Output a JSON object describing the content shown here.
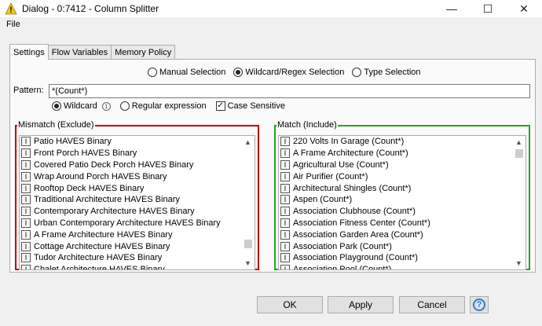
{
  "window": {
    "title": "Dialog - 0:7412 - Column Splitter",
    "minimize": "—",
    "maximize": "☐",
    "close": "✕"
  },
  "menu": {
    "file": "File"
  },
  "tabs": [
    {
      "label": "Settings",
      "active": true
    },
    {
      "label": "Flow Variables",
      "active": false
    },
    {
      "label": "Memory Policy",
      "active": false
    }
  ],
  "selection_modes": [
    {
      "label": "Manual Selection",
      "selected": false
    },
    {
      "label": "Wildcard/Regex Selection",
      "selected": true
    },
    {
      "label": "Type Selection",
      "selected": false
    }
  ],
  "pattern": {
    "label": "Pattern:",
    "value": "*(Count*)"
  },
  "pattern_options": {
    "wildcard": "Wildcard",
    "info": "i",
    "regex": "Regular expression",
    "case_sensitive": "Case Sensitive",
    "case_check": "✓"
  },
  "type_icon": "I",
  "mismatch": {
    "legend": "Mismatch (Exclude)",
    "items": [
      "Patio HAVES Binary",
      "Front Porch HAVES Binary",
      "Covered Patio Deck Porch HAVES Binary",
      "Wrap Around Porch HAVES Binary",
      "Rooftop Deck HAVES Binary",
      "Traditional Architecture HAVES Binary",
      "Contemporary Architecture HAVES Binary",
      "Urban Contemporary Architecture HAVES Binary",
      "A Frame Architecture HAVES Binary",
      "Cottage Architecture HAVES Binary",
      "Tudor Architecture HAVES Binary",
      "Chalet Architecture HAVES Binary"
    ]
  },
  "match": {
    "legend": "Match (Include)",
    "items": [
      "220 Volts In Garage (Count*)",
      "A Frame Architecture (Count*)",
      "Agricultural Use (Count*)",
      "Air Purifier (Count*)",
      "Architectural Shingles (Count*)",
      "Aspen (Count*)",
      "Association Clubhouse (Count*)",
      "Association Fitness Center (Count*)",
      "Association Garden Area (Count*)",
      "Association Park (Count*)",
      "Association Playground (Count*)",
      "Association Pool (Count*)"
    ]
  },
  "scroll": {
    "up": "▲",
    "down": "▼"
  },
  "buttons": {
    "ok": "OK",
    "apply": "Apply",
    "cancel": "Cancel",
    "help": "?"
  }
}
